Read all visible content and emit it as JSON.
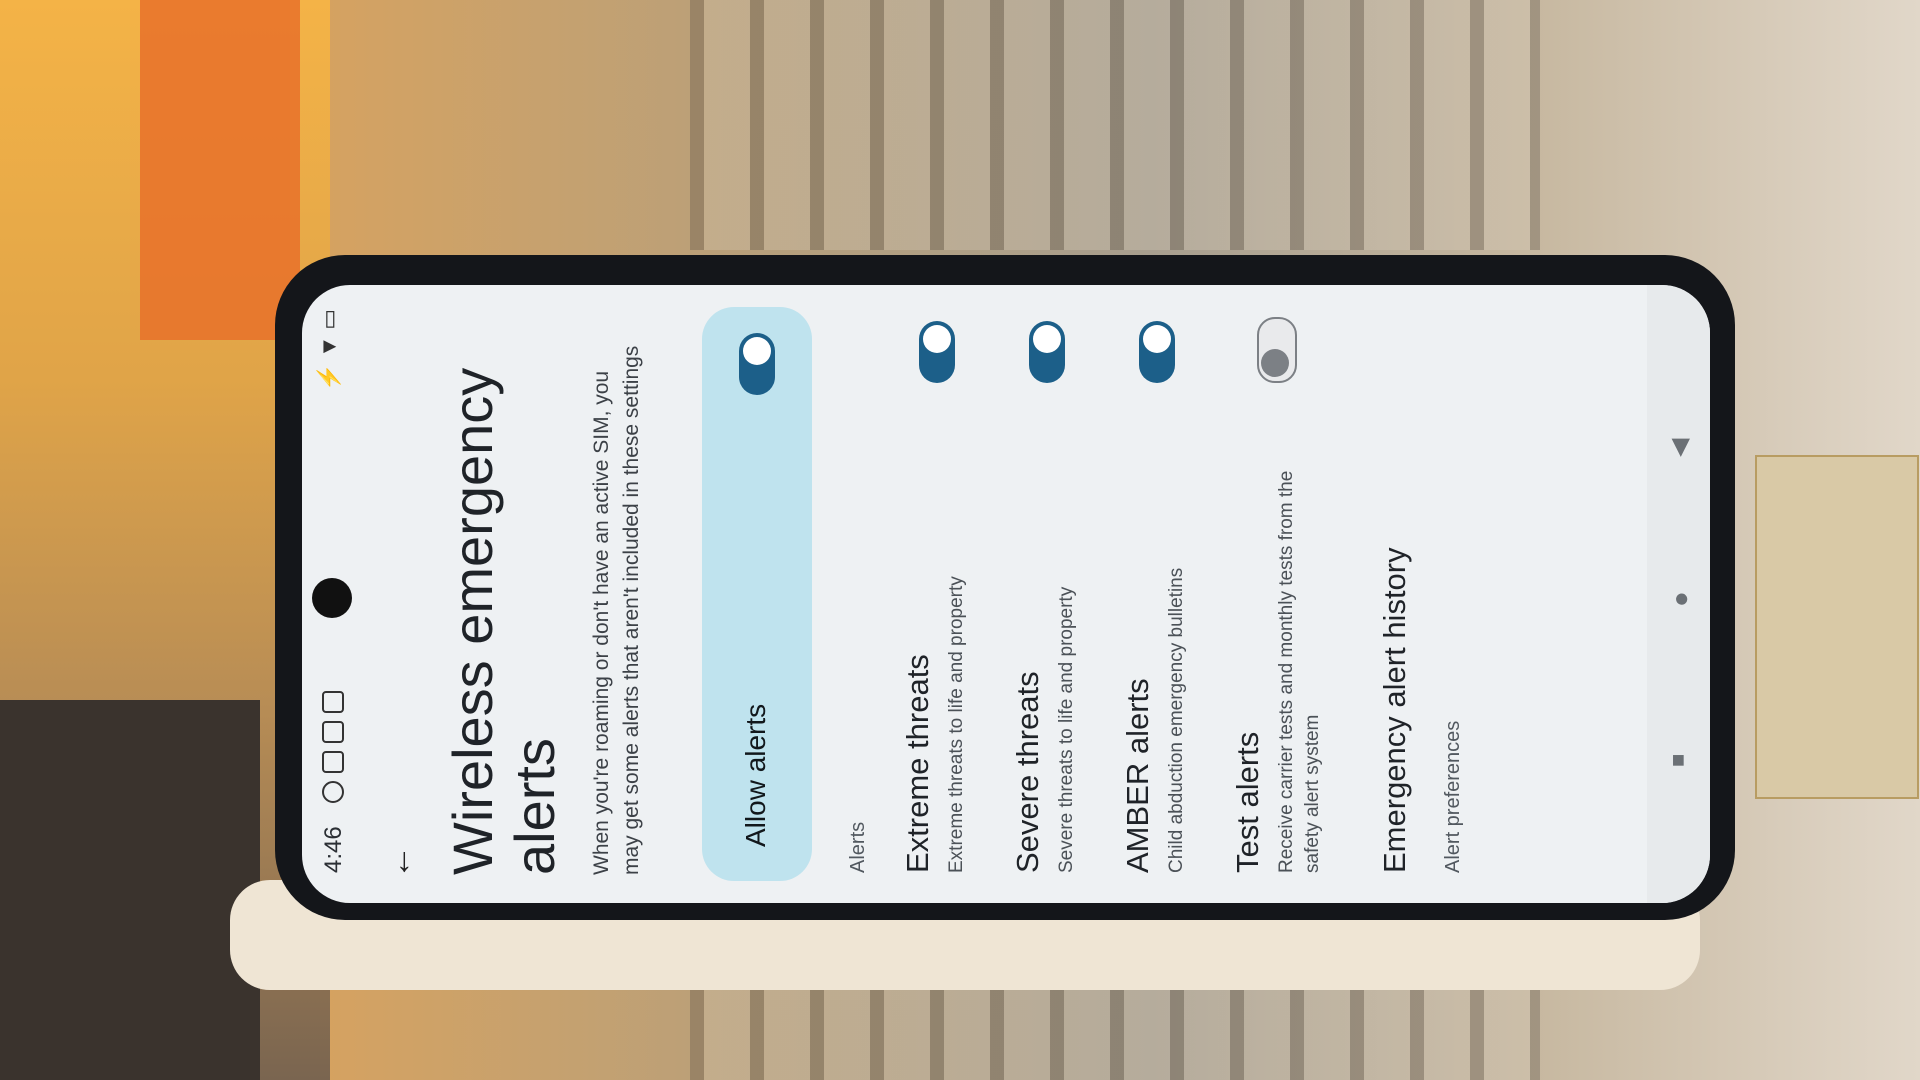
{
  "status_bar": {
    "time": "4:46"
  },
  "header": {
    "back_icon": "arrow-back-icon",
    "title": "Wireless emergency alerts",
    "description": "When you're roaming or don't have an active SIM, you may get some alerts that aren't included in these settings"
  },
  "allow_alerts": {
    "label": "Allow alerts",
    "enabled": true
  },
  "sections": {
    "alerts": "Alerts",
    "preferences": "Alert preferences"
  },
  "alerts": [
    {
      "title": "Extreme threats",
      "subtitle": "Extreme threats to life and property",
      "enabled": true
    },
    {
      "title": "Severe threats",
      "subtitle": "Severe threats to life and property",
      "enabled": true
    },
    {
      "title": "AMBER alerts",
      "subtitle": "Child abduction emergency bulletins",
      "enabled": true
    },
    {
      "title": "Test alerts",
      "subtitle": "Receive carrier tests and monthly tests from the safety alert system",
      "enabled": false
    }
  ],
  "history": {
    "label": "Emergency alert history"
  },
  "colors": {
    "toggle_on": "#1c5f89",
    "allow_card": "#bfe3ee",
    "screen_bg": "#eef1f3"
  }
}
